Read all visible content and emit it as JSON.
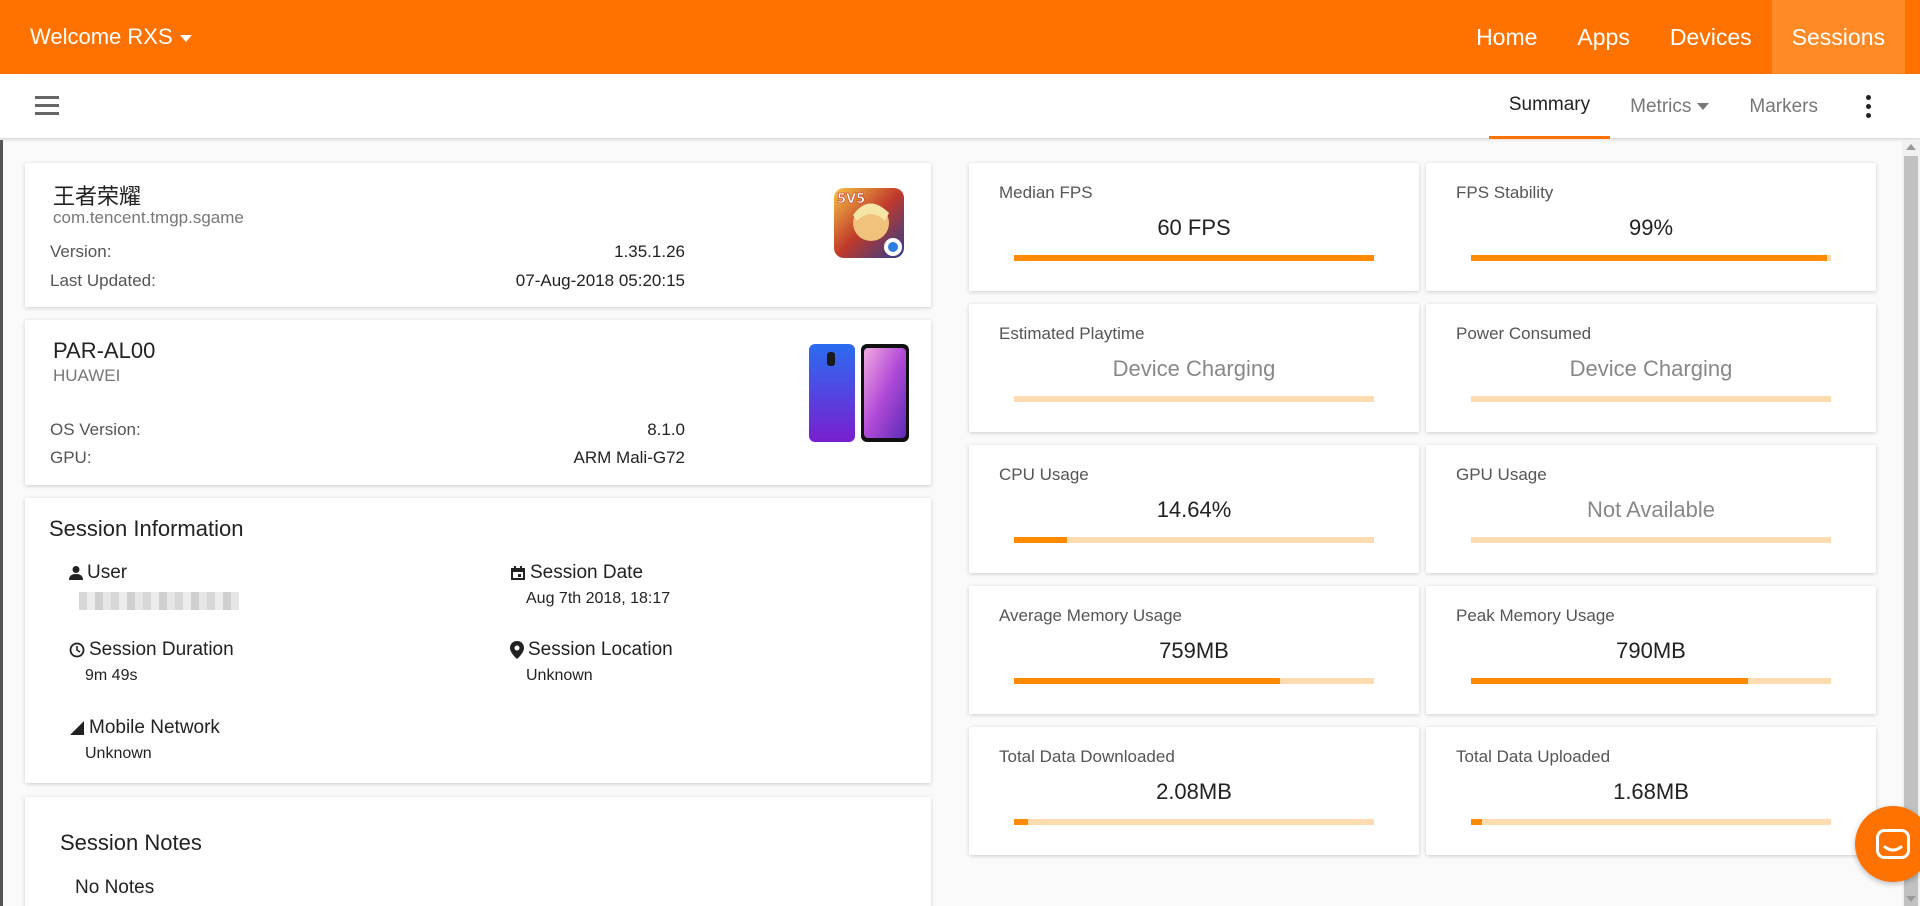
{
  "topbar": {
    "welcome": "Welcome RXS",
    "nav": [
      "Home",
      "Apps",
      "Devices",
      "Sessions"
    ]
  },
  "subnav": {
    "tabs": [
      "Summary",
      "Metrics",
      "Markers"
    ]
  },
  "app": {
    "name": "王者荣耀",
    "package": "com.tencent.tmgp.sgame",
    "version_label": "Version:",
    "version": "1.35.1.26",
    "updated_label": "Last Updated:",
    "updated": "07-Aug-2018 05:20:15",
    "icon_badge": "5V5"
  },
  "device": {
    "model": "PAR-AL00",
    "maker": "HUAWEI",
    "os_label": "OS Version:",
    "os": "8.1.0",
    "gpu_label": "GPU:",
    "gpu": "ARM Mali-G72"
  },
  "session": {
    "title": "Session Information",
    "user_label": "User",
    "date_label": "Session Date",
    "date": "Aug 7th 2018, 18:17",
    "duration_label": "Session Duration",
    "duration": "9m 49s",
    "location_label": "Session Location",
    "location": "Unknown",
    "network_label": "Mobile Network",
    "network": "Unknown"
  },
  "notes": {
    "title": "Session Notes",
    "text": "No Notes"
  },
  "metrics": [
    {
      "label": "Median FPS",
      "value": "60 FPS",
      "fill": 1.0,
      "muted": false
    },
    {
      "label": "FPS Stability",
      "value": "99%",
      "fill": 0.99,
      "muted": false
    },
    {
      "label": "Estimated Playtime",
      "value": "Device Charging",
      "fill": 0,
      "muted": true
    },
    {
      "label": "Power Consumed",
      "value": "Device Charging",
      "fill": 0,
      "muted": true
    },
    {
      "label": "CPU Usage",
      "value": "14.64%",
      "fill": 0.1464,
      "muted": false
    },
    {
      "label": "GPU Usage",
      "value": "Not Available",
      "fill": 0,
      "muted": true
    },
    {
      "label": "Average Memory Usage",
      "value": "759MB",
      "fill": 0.74,
      "muted": false
    },
    {
      "label": "Peak Memory Usage",
      "value": "790MB",
      "fill": 0.77,
      "muted": false
    },
    {
      "label": "Total Data Downloaded",
      "value": "2.08MB",
      "fill": 0.04,
      "muted": false
    },
    {
      "label": "Total Data Uploaded",
      "value": "1.68MB",
      "fill": 0.03,
      "muted": false
    }
  ],
  "colors": {
    "brand": "#ff7200",
    "bar": "#ff8a00",
    "bar_track": "#ffdcb0"
  }
}
